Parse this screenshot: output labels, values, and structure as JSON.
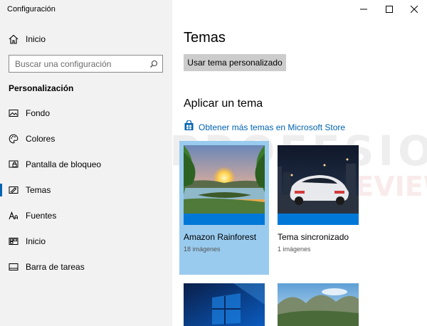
{
  "window": {
    "title": "Configuración",
    "controls": [
      "minimize",
      "maximize",
      "close"
    ]
  },
  "sidebar": {
    "home_label": "Inicio",
    "search_placeholder": "Buscar una configuración",
    "section_title": "Personalización",
    "items": [
      {
        "label": "Fondo",
        "icon": "image-icon",
        "selected": false
      },
      {
        "label": "Colores",
        "icon": "palette-icon",
        "selected": false
      },
      {
        "label": "Pantalla de bloqueo",
        "icon": "lock-screen-icon",
        "selected": false
      },
      {
        "label": "Temas",
        "icon": "themes-icon",
        "selected": true
      },
      {
        "label": "Fuentes",
        "icon": "fonts-icon",
        "selected": false
      },
      {
        "label": "Inicio",
        "icon": "start-icon",
        "selected": false
      },
      {
        "label": "Barra de tareas",
        "icon": "taskbar-icon",
        "selected": false
      }
    ]
  },
  "main": {
    "page_title": "Temas",
    "custom_theme_button": "Usar tema personalizado",
    "apply_heading": "Aplicar un tema",
    "store_link": "Obtener más temas en Microsoft Store",
    "themes": [
      {
        "name": "Amazon Rainforest",
        "count": "18 imágenes",
        "selected": true
      },
      {
        "name": "Tema sincronizado",
        "count": "1 imágenes",
        "selected": false
      },
      {
        "name": "",
        "count": "",
        "selected": false
      },
      {
        "name": "",
        "count": "",
        "selected": false
      }
    ]
  },
  "watermark": {
    "text": "PROFESIONAL",
    "text2": "REVIEW"
  },
  "colors": {
    "accent": "#0063b1",
    "selection": "#99cbee",
    "sidebar_bg": "#f2f2f2",
    "button_bg": "#cccccc"
  }
}
